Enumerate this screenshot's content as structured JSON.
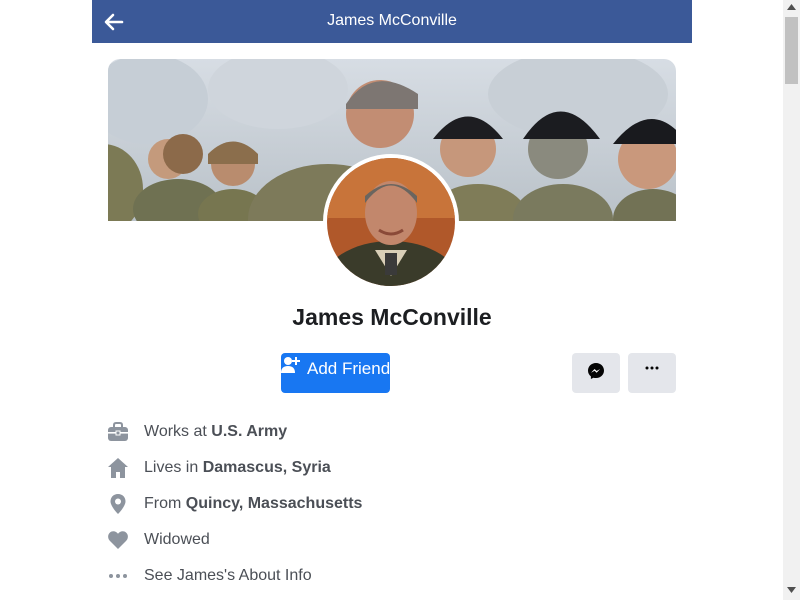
{
  "header": {
    "title": "James McConville",
    "back_icon": "arrow-left-icon"
  },
  "profile": {
    "name": "James McConville",
    "cover_alt": "Cover photo: officer with soldiers in winter gear",
    "avatar_alt": "Profile photo"
  },
  "actions": {
    "add_friend_label": "Add Friend",
    "add_friend_icon": "person-plus-icon",
    "messenger_icon": "messenger-icon",
    "more_icon": "more-dots-icon"
  },
  "info": [
    {
      "icon": "briefcase-icon",
      "prefix": "Works at ",
      "bold": "U.S. Army"
    },
    {
      "icon": "home-icon",
      "prefix": "Lives in ",
      "bold": "Damascus, Syria"
    },
    {
      "icon": "location-pin-icon",
      "prefix": "From ",
      "bold": "Quincy, Massachusetts"
    },
    {
      "icon": "heart-icon",
      "prefix": "Widowed",
      "bold": ""
    },
    {
      "icon": "more-dots-icon",
      "prefix": "See James's About Info",
      "bold": ""
    }
  ],
  "colors": {
    "header_bg": "#3b5998",
    "primary_button": "#1877f2",
    "secondary_button": "#e4e6eb",
    "icon_gray": "#8d949e",
    "text": "#4b4f56",
    "name_text": "#1c1e21"
  }
}
